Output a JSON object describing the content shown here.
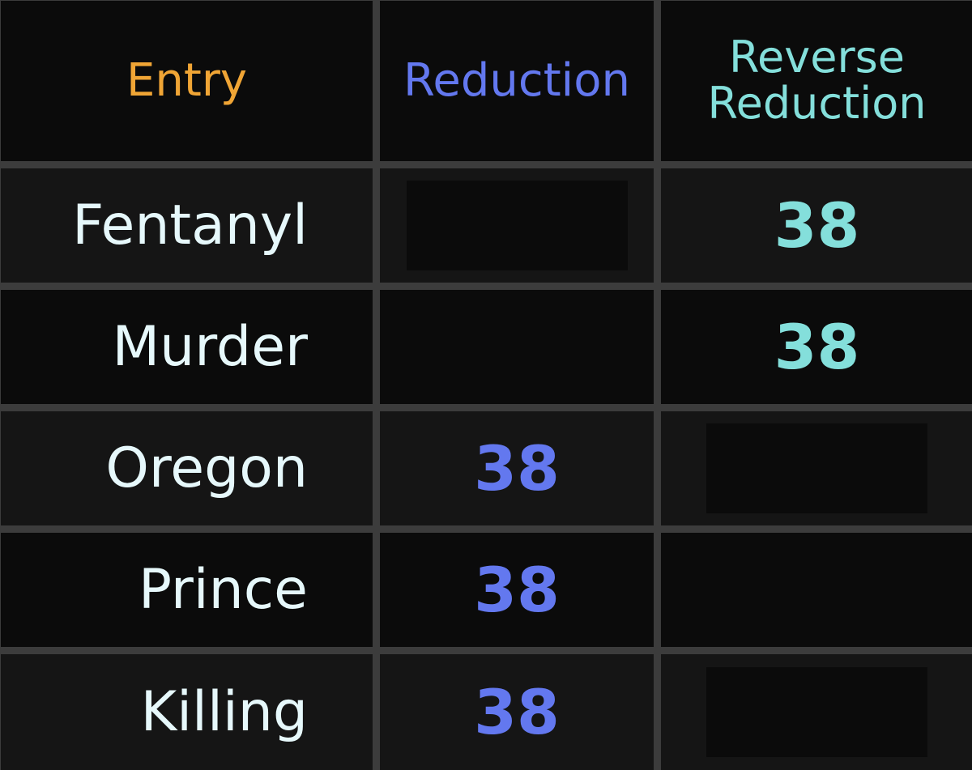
{
  "headers": {
    "entry": "Entry",
    "reduction": "Reduction",
    "reverse_reduction": "Reverse\nReduction"
  },
  "colors": {
    "entry": "#f0a535",
    "reduction": "#6378ef",
    "reverse_reduction": "#84dfdb",
    "text": "#e6f8fb",
    "grid": "#3c3c3c"
  },
  "rows": [
    {
      "entry": "Fentanyl",
      "reduction": "",
      "reverse_reduction": "38"
    },
    {
      "entry": "Murder",
      "reduction": "",
      "reverse_reduction": "38"
    },
    {
      "entry": "Oregon",
      "reduction": "38",
      "reverse_reduction": ""
    },
    {
      "entry": "Prince",
      "reduction": "38",
      "reverse_reduction": ""
    },
    {
      "entry": "Killing",
      "reduction": "38",
      "reverse_reduction": ""
    }
  ]
}
